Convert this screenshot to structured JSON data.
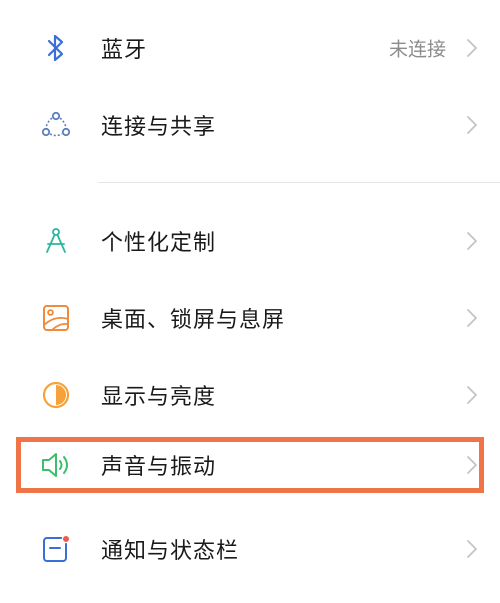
{
  "settings": {
    "items": [
      {
        "label": "蓝牙",
        "value": "未连接",
        "icon": "bluetooth-icon"
      },
      {
        "label": "连接与共享",
        "icon": "connection-sharing-icon"
      },
      {
        "label": "个性化定制",
        "icon": "compass-personalization-icon"
      },
      {
        "label": "桌面、锁屏与息屏",
        "icon": "wallpaper-icon"
      },
      {
        "label": "显示与亮度",
        "icon": "brightness-icon"
      },
      {
        "label": "声音与振动",
        "icon": "speaker-icon",
        "highlighted": true
      },
      {
        "label": "通知与状态栏",
        "icon": "notification-icon"
      }
    ]
  },
  "colors": {
    "bluetooth": "#3a6fd8",
    "connection": "#5b7fbf",
    "personalization": "#2bb5a0",
    "wallpaper": "#f08a3c",
    "brightness": "#f5a23a",
    "sound": "#3bbf6a",
    "notification": "#3a6fd8",
    "notification_dot": "#ef5a4a",
    "highlight": "#ef7447",
    "chevron": "#c4c4c4"
  }
}
